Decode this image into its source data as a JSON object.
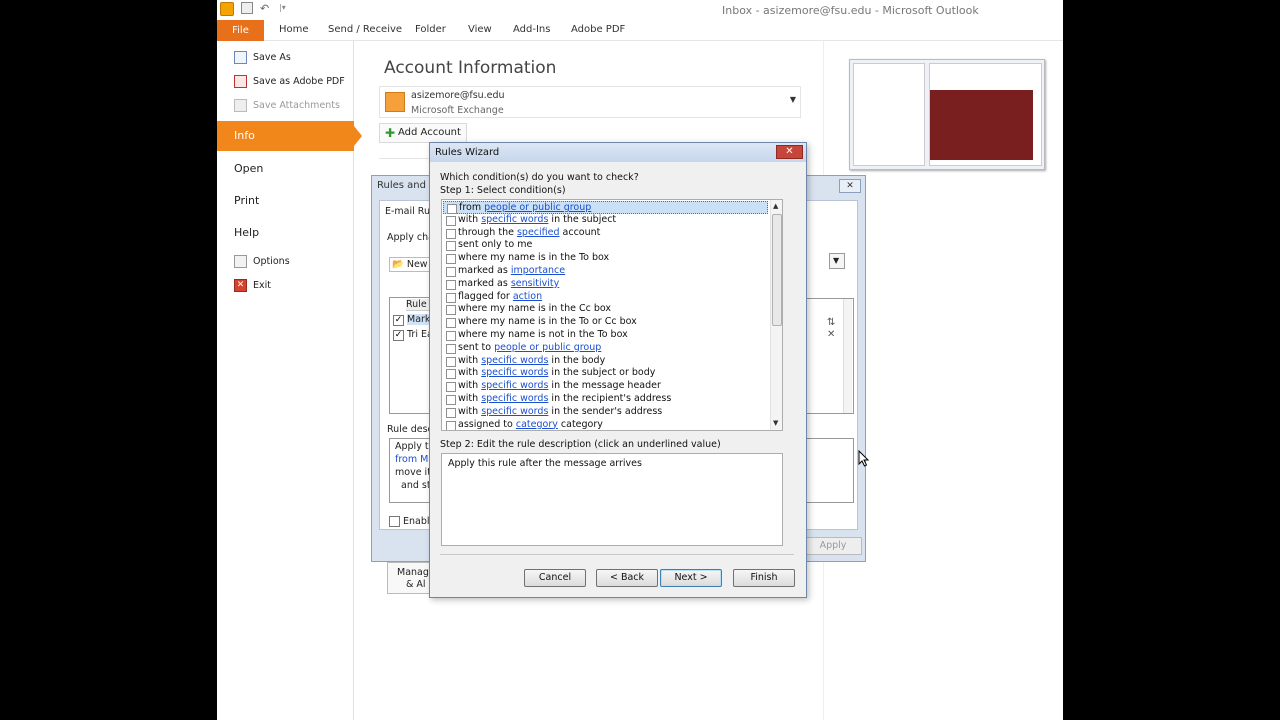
{
  "window": {
    "title": "Inbox - asizemore@fsu.edu  -  Microsoft Outlook"
  },
  "ribbon": {
    "tabs": [
      "File",
      "Home",
      "Send / Receive",
      "Folder",
      "View",
      "Add-Ins",
      "Adobe PDF"
    ]
  },
  "backstage": {
    "small_items": [
      {
        "label": "Save As",
        "enabled": true
      },
      {
        "label": "Save as Adobe PDF",
        "enabled": true
      },
      {
        "label": "Save Attachments",
        "enabled": false
      }
    ],
    "big_items": [
      "Info",
      "Open",
      "Print",
      "Help"
    ],
    "bottom_items": [
      {
        "label": "Options"
      },
      {
        "label": "Exit"
      }
    ]
  },
  "account": {
    "title": "Account Information",
    "email": "asizemore@fsu.edu",
    "type": "Microsoft Exchange",
    "add_button": "Add Account"
  },
  "rules_alerts": {
    "title": "Rules and A",
    "tab": "E-mail Rule",
    "apply_label": "Apply chan",
    "new_rule": "New R",
    "rule_header": "Rule (",
    "rules": [
      {
        "name": "Mark I",
        "checked": true
      },
      {
        "name": "Tri Ea",
        "checked": true
      }
    ],
    "desc_label": "Rule descr",
    "desc_lines": [
      "Apply thi",
      "from Mar",
      "move it t",
      "and sto"
    ],
    "enable_label": "Enable",
    "apply_button": "Apply",
    "manage_lines": [
      "Manag",
      "& Al"
    ]
  },
  "wizard": {
    "title": "Rules Wizard",
    "question": "Which condition(s) do you want to check?",
    "step1": "Step 1: Select condition(s)",
    "conditions": [
      {
        "pre": "from ",
        "link": "people or public group",
        "post": "",
        "selected": true
      },
      {
        "pre": "with ",
        "link": "specific words",
        "post": " in the subject"
      },
      {
        "pre": "through the ",
        "link": "specified",
        "post": " account"
      },
      {
        "pre": "sent only to me",
        "link": "",
        "post": ""
      },
      {
        "pre": "where my name is in the To box",
        "link": "",
        "post": ""
      },
      {
        "pre": "marked as ",
        "link": "importance",
        "post": ""
      },
      {
        "pre": "marked as ",
        "link": "sensitivity",
        "post": ""
      },
      {
        "pre": "flagged for ",
        "link": "action",
        "post": ""
      },
      {
        "pre": "where my name is in the Cc box",
        "link": "",
        "post": ""
      },
      {
        "pre": "where my name is in the To or Cc box",
        "link": "",
        "post": ""
      },
      {
        "pre": "where my name is not in the To box",
        "link": "",
        "post": ""
      },
      {
        "pre": "sent to ",
        "link": "people or public group",
        "post": ""
      },
      {
        "pre": "with ",
        "link": "specific words",
        "post": " in the body"
      },
      {
        "pre": "with ",
        "link": "specific words",
        "post": " in the subject or body"
      },
      {
        "pre": "with ",
        "link": "specific words",
        "post": " in the message header"
      },
      {
        "pre": "with ",
        "link": "specific words",
        "post": " in the recipient's address"
      },
      {
        "pre": "with ",
        "link": "specific words",
        "post": " in the sender's address"
      },
      {
        "pre": "assigned to ",
        "link": "category",
        "post": " category"
      }
    ],
    "step2": "Step 2: Edit the rule description (click an underlined value)",
    "description": "Apply this rule after the message arrives",
    "buttons": {
      "cancel": "Cancel",
      "back": "< Back",
      "next": "Next >",
      "finish": "Finish"
    }
  },
  "colors": {
    "file_tab": "#e8701a",
    "info_selected": "#f1861a",
    "link": "#1a4fcf"
  }
}
